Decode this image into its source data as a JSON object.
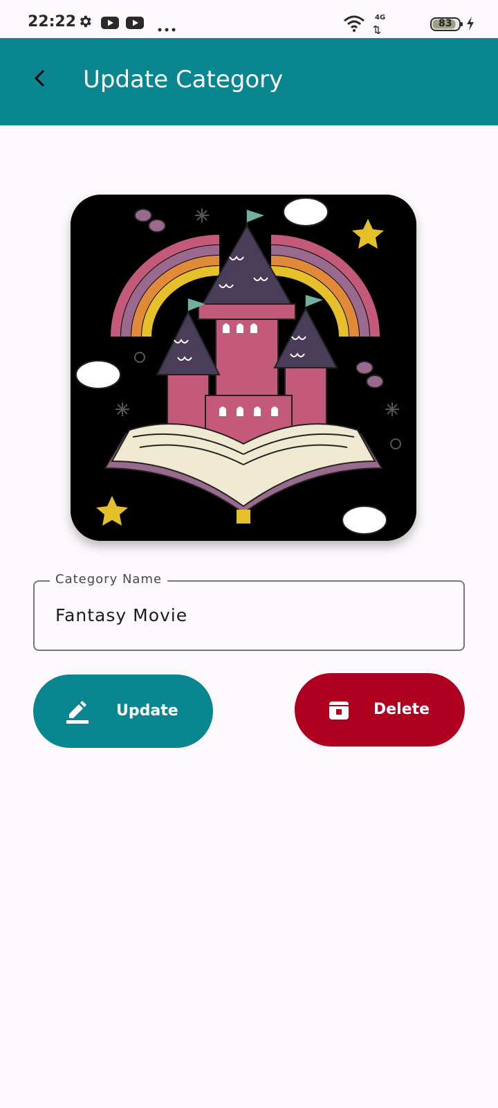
{
  "status_bar": {
    "time": "22:22",
    "network": "4G",
    "battery": "83",
    "icons": [
      "settings-icon",
      "youtube-icon",
      "youtube-icon",
      "more-dots-icon",
      "wifi-icon",
      "signal-icon",
      "battery-icon",
      "charging-icon"
    ]
  },
  "app_bar": {
    "title": "Update Category",
    "back_icon": "back-arrow-icon",
    "color": "#0a8690"
  },
  "category_image": {
    "icon": "castle-book-illustration"
  },
  "form": {
    "label": "Category Name",
    "value": "Fantasy Movie"
  },
  "buttons": {
    "update": {
      "label": "Update",
      "icon": "edit-icon",
      "color": "#0a8690"
    },
    "delete": {
      "label": "Delete",
      "icon": "delete-icon",
      "color": "#b00020"
    }
  }
}
